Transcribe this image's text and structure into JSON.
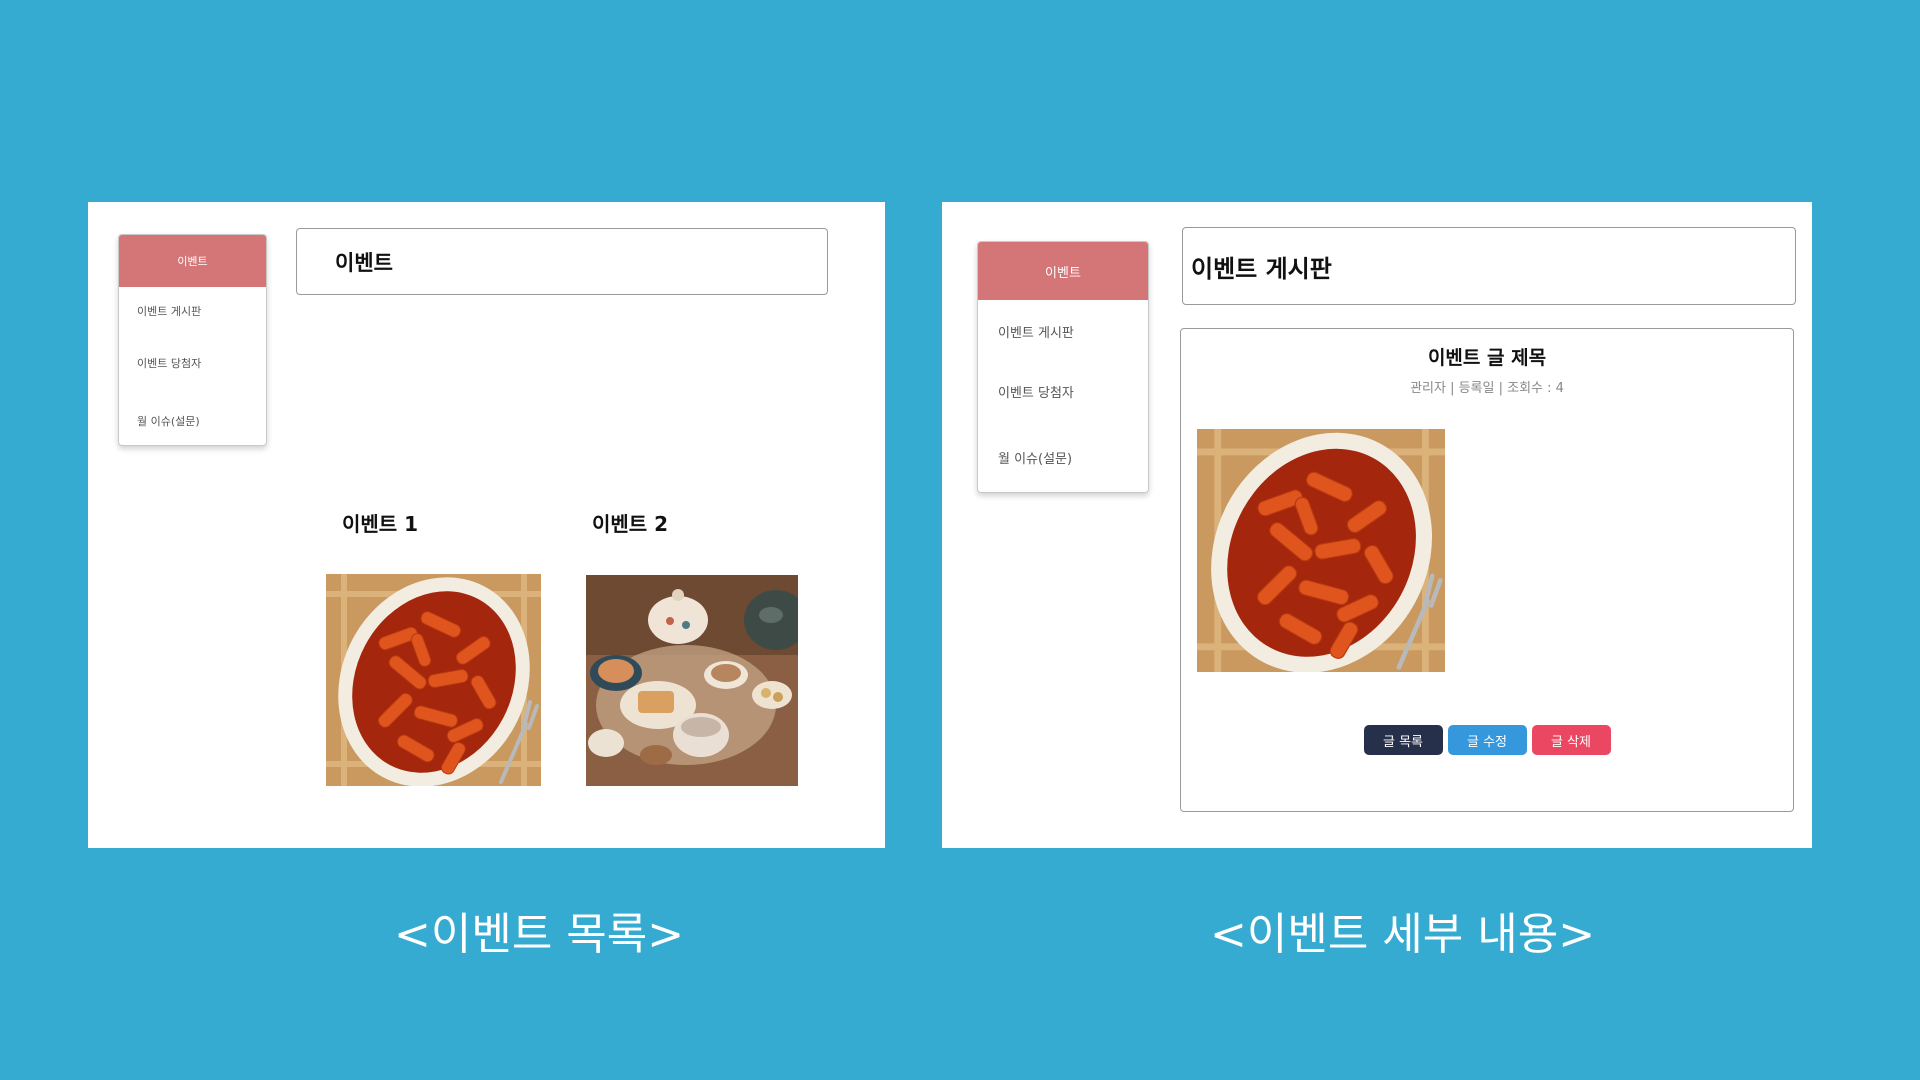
{
  "colors": {
    "background": "#36abd1",
    "sidebar_active": "#d47577",
    "btn_list": "#27304a",
    "btn_edit": "#3597dc",
    "btn_delete": "#ec4762"
  },
  "list_screen": {
    "sidebar": {
      "active_label": "이벤트",
      "items": [
        {
          "label": "이벤트 게시판"
        },
        {
          "label": "이벤트 당첨자"
        },
        {
          "label": "월 이슈(설문)"
        }
      ]
    },
    "title": "이벤트",
    "events": [
      {
        "label": "이벤트 1",
        "image": "tteokbokki"
      },
      {
        "label": "이벤트 2",
        "image": "tea-table"
      }
    ],
    "caption": "<이벤트 목록>"
  },
  "detail_screen": {
    "sidebar": {
      "active_label": "이벤트",
      "items": [
        {
          "label": "이벤트 게시판"
        },
        {
          "label": "이벤트 당첨자"
        },
        {
          "label": "월 이슈(설문)"
        }
      ]
    },
    "title": "이벤트 게시판",
    "post": {
      "title": "이벤트 글 제목",
      "meta": "관리자 | 등록일 | 조회수 : 4",
      "image": "tteokbokki"
    },
    "buttons": {
      "list": "글 목록",
      "edit": "글 수정",
      "delete": "글 삭제"
    },
    "caption": "<이벤트 세부 내용>"
  }
}
